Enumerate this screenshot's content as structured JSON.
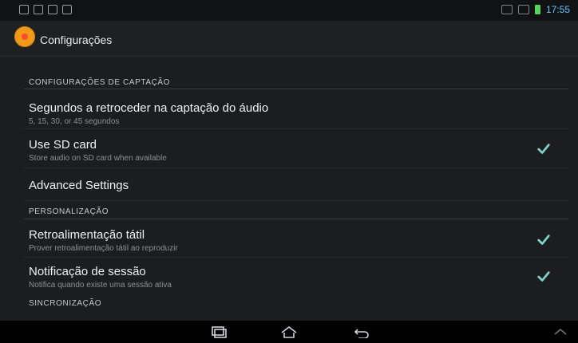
{
  "status_bar": {
    "time": "17:55"
  },
  "app": {
    "title": "Configurações"
  },
  "sections": [
    {
      "header": "CONFIGURAÇÕES DE CAPTAÇÃO",
      "items": [
        {
          "title": "Segundos a retroceder na captação do áudio",
          "subtitle": "5, 15, 30, or 45 segundos",
          "has_checkbox": false
        },
        {
          "title": "Use SD card",
          "subtitle": "Store audio on SD card when available",
          "has_checkbox": true,
          "checked": true
        },
        {
          "title": "Advanced Settings",
          "subtitle": "",
          "has_checkbox": false
        }
      ]
    },
    {
      "header": "PERSONALIZAÇÃO",
      "items": [
        {
          "title": "Retroalimentação tátil",
          "subtitle": "Prover retroalimentação tátil ao reproduzir",
          "has_checkbox": true,
          "checked": true
        },
        {
          "title": "Notificação de sessão",
          "subtitle": "Notifica quando existe uma sessão ativa",
          "has_checkbox": true,
          "checked": true
        }
      ]
    }
  ],
  "partial_section_header": "SINCRONIZAÇÃO",
  "colors": {
    "background": "#1c1d1f",
    "status_bar": "#111214",
    "action_bar": "#1f2022",
    "accent_orange": "#f09a1a",
    "check_teal": "#7fd2c8"
  },
  "icons": {
    "app_logo": "app-logo-icon",
    "back": "back-icon",
    "home": "home-icon",
    "recent_apps": "recent-apps-icon",
    "more": "more-icon"
  }
}
